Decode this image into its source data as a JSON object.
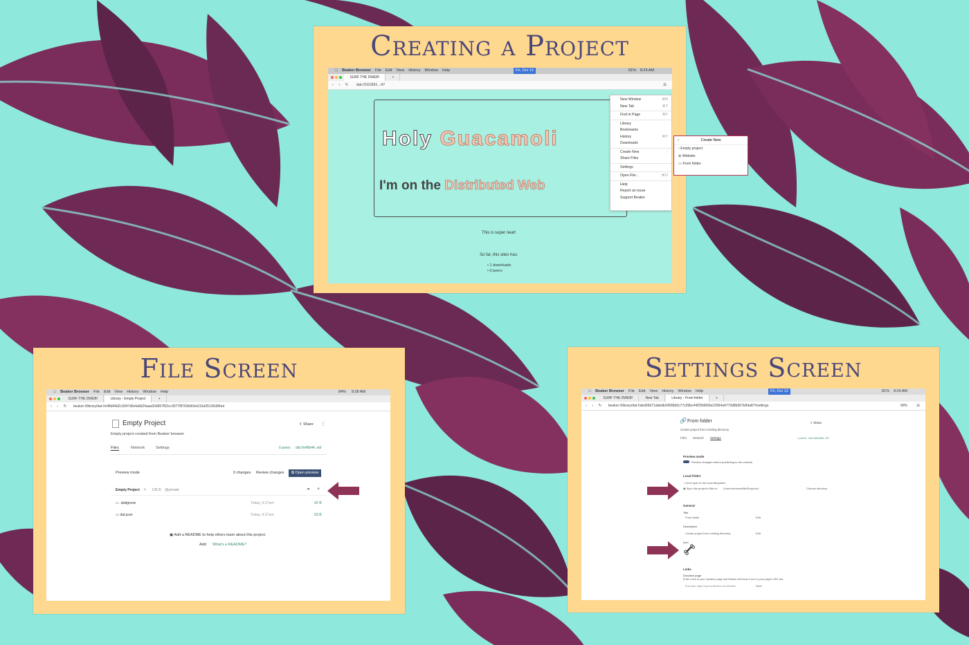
{
  "panels": {
    "create": {
      "title": "Creating a Project"
    },
    "file": {
      "title": "File Screen"
    },
    "settings": {
      "title": "Settings Screen"
    }
  },
  "colors": {
    "background": "#8ee9dc",
    "leaf": "#7a2d5a",
    "panel": "#ffd88f",
    "title": "#4a4778",
    "arrow": "#8e3355"
  },
  "mac_menu": {
    "app": "Beaker Browser",
    "items": [
      "File",
      "Edit",
      "View",
      "History",
      "Window",
      "Help"
    ],
    "date": "Fri, Oct 13"
  },
  "create_screen": {
    "tab": "SURF THE DWEB!",
    "clock": "8:24 AM",
    "battery": "81%",
    "url": "dat://161891...47",
    "headline1a": "Holy",
    "headline1b": "Guacamoli",
    "headline2a": "I'm on the",
    "headline2b": "Distributed Web",
    "super_neat": "This is super neat!",
    "so_far": "So far, this sites has:",
    "stats": [
      "1 downloads",
      "0 peers"
    ],
    "menu": [
      {
        "label": "New Window",
        "shortcut": "⌘N"
      },
      {
        "label": "New Tab",
        "shortcut": "⌘T"
      },
      {
        "sep": true
      },
      {
        "label": "Find in Page",
        "shortcut": "⌘F"
      },
      {
        "sep": true
      },
      {
        "label": "Library"
      },
      {
        "label": "Bookmarks"
      },
      {
        "label": "History",
        "shortcut": "⌘Y"
      },
      {
        "label": "Downloads"
      },
      {
        "sep": true
      },
      {
        "label": "Create New",
        "shortcut": "›"
      },
      {
        "label": "Share Files"
      },
      {
        "sep": true
      },
      {
        "label": "Settings"
      },
      {
        "sep": true
      },
      {
        "label": "Open File...",
        "shortcut": "⌘O"
      },
      {
        "sep": true
      },
      {
        "label": "Help"
      },
      {
        "label": "Report an issue"
      },
      {
        "label": "Support Beaker"
      }
    ],
    "submenu": {
      "title": "Create New",
      "items": [
        "Empty project",
        "Website",
        "From folder"
      ]
    }
  },
  "file_screen": {
    "tab1": "SURF THE DWEB!",
    "tab2": "Library - Empty Project",
    "clock": "9:28 AM",
    "battery": "84%",
    "url": "beaker://library/dat://e48d44d2c3047d6efa6b24aaa93d957f63cc3077f8769b90dc616d35136d96ed",
    "project_title": "Empty Project",
    "share": "Share",
    "description": "Empty project created from Beaker browser",
    "tabs": [
      "Files",
      "Network",
      "Settings"
    ],
    "peers": "0 peers",
    "dat_link": "dat://e48d44..ed/",
    "preview_mode": "Preview mode",
    "changes": "0 changes",
    "review": "Review changes",
    "open_preview": "Open preview",
    "folder_name": "Empty Project",
    "folder_size": "135 B",
    "owner": "@private",
    "files": [
      {
        "name": ".datignore",
        "date": "Today, 9:27am",
        "size": "42 B"
      },
      {
        "name": "dat.json",
        "date": "Today, 9:27am",
        "size": "93 B"
      }
    ],
    "readme_prompt": "Add a README to help others learn about this project.",
    "add": "Add",
    "whats_readme": "What's a README?"
  },
  "settings_screen": {
    "tab1": "SURF THE DWEB!",
    "tab2": "New Tab",
    "tab3": "Library - From folder",
    "clock": "9:24 AM",
    "battery": "81%",
    "url": "beaker://library/dat://abd36d71dabdb34589d3c77c09bc44f25fd960e22964a4779d8b967b84a87#settings",
    "zoom": "90%",
    "project_title": "From folder",
    "share": "Share",
    "description": "Create project from existing directory",
    "tabs": [
      "Files",
      "Network",
      "Settings"
    ],
    "peers": "1 peers",
    "dat_link": "dat://abd36d..87/",
    "preview_heading": "Preview mode",
    "preview_text": "Preview changes before publishing to the network",
    "local_heading": "Local folder",
    "local_opt1": "Don't sync to the local filesystem",
    "local_opt2": "Sync this project's files to",
    "local_path": "/Users/renamedfile/Dropbox/...",
    "choose_dir": "Choose directory",
    "general": "General",
    "title_label": "Title",
    "title_value": "From folder",
    "edit1": "Edit",
    "desc_label": "Description",
    "desc_value": "Create project from existing directory",
    "edit2": "Edit",
    "icon_label": "Icon",
    "links": "Links",
    "donate_label": "Donation page",
    "donate_text": "Enter a link to your donation page and Beaker will show a icon in your page's URL bar.",
    "donate_placeholder": "Example: https://opencollective.com/beaker",
    "save": "Save"
  }
}
